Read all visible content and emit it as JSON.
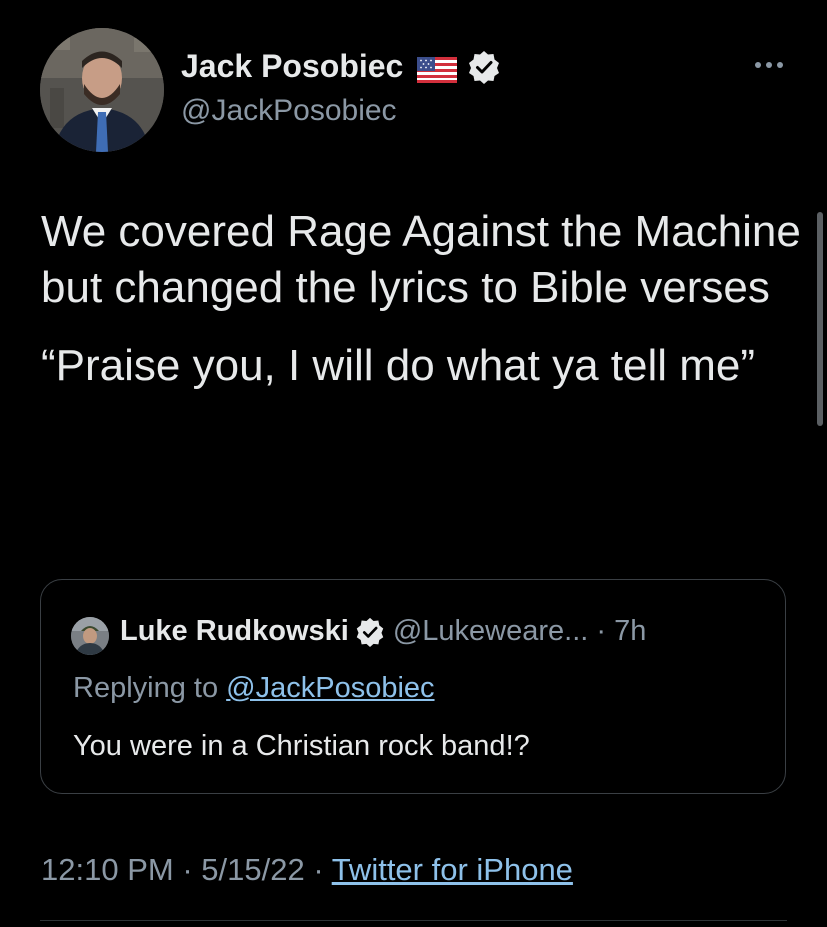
{
  "author": {
    "display_name": "Jack Posobiec",
    "handle": "@JackPosobiec"
  },
  "tweet": {
    "paragraphs": [
      "We covered Rage Against the Machine but changed the lyrics to Bible verses",
      "“Praise you, I will do what ya tell me”"
    ]
  },
  "quote": {
    "display_name": "Luke Rudkowski",
    "handle": "@Lukeweare...",
    "separator": " · ",
    "time": "7h",
    "replying_prefix": "Replying to ",
    "replying_to": "@JackPosobiec",
    "text": "You were in a Christian rock band!?"
  },
  "meta": {
    "time": "12:10 PM",
    "sep1": " · ",
    "date": "5/15/22",
    "sep2": " · ",
    "source": "Twitter for iPhone"
  },
  "icons": {
    "flag": "us-flag-icon",
    "verified": "verified-badge-icon",
    "more": "more-options-icon"
  },
  "colors": {
    "background": "#000000",
    "primary_text": "#e7e9ea",
    "secondary_text": "#8b98a5",
    "link": "#8ec1ea",
    "border": "#3a3f44"
  }
}
